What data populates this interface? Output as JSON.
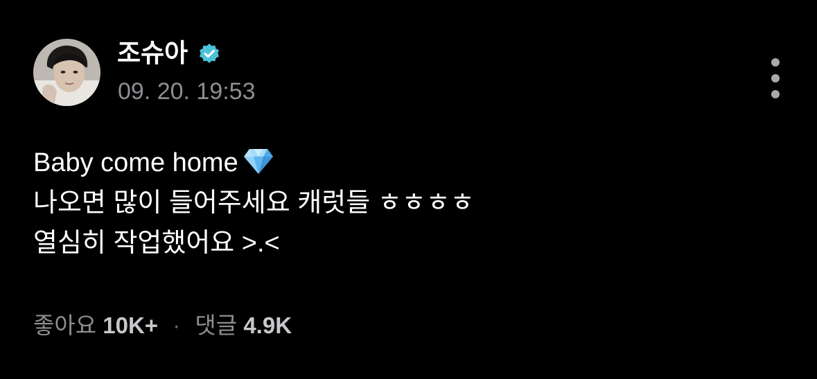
{
  "post": {
    "author": {
      "name": "조슈아",
      "verified": true,
      "verified_color": "#4cc2d9"
    },
    "timestamp": "09. 20. 19:53",
    "content_lines": [
      "Baby come home",
      "나오면 많이 들어주세요 캐럿들 ㅎㅎㅎㅎ",
      "열심히 작업했어요 >.<"
    ],
    "emoji_line1": "gem-stone",
    "stats": {
      "likes_label": "좋아요",
      "likes_value": "10K+",
      "separator": "·",
      "comments_label": "댓글",
      "comments_value": "4.9K"
    }
  },
  "theme": {
    "background": "#000000",
    "text": "#ffffff",
    "muted": "#8e8e93"
  }
}
